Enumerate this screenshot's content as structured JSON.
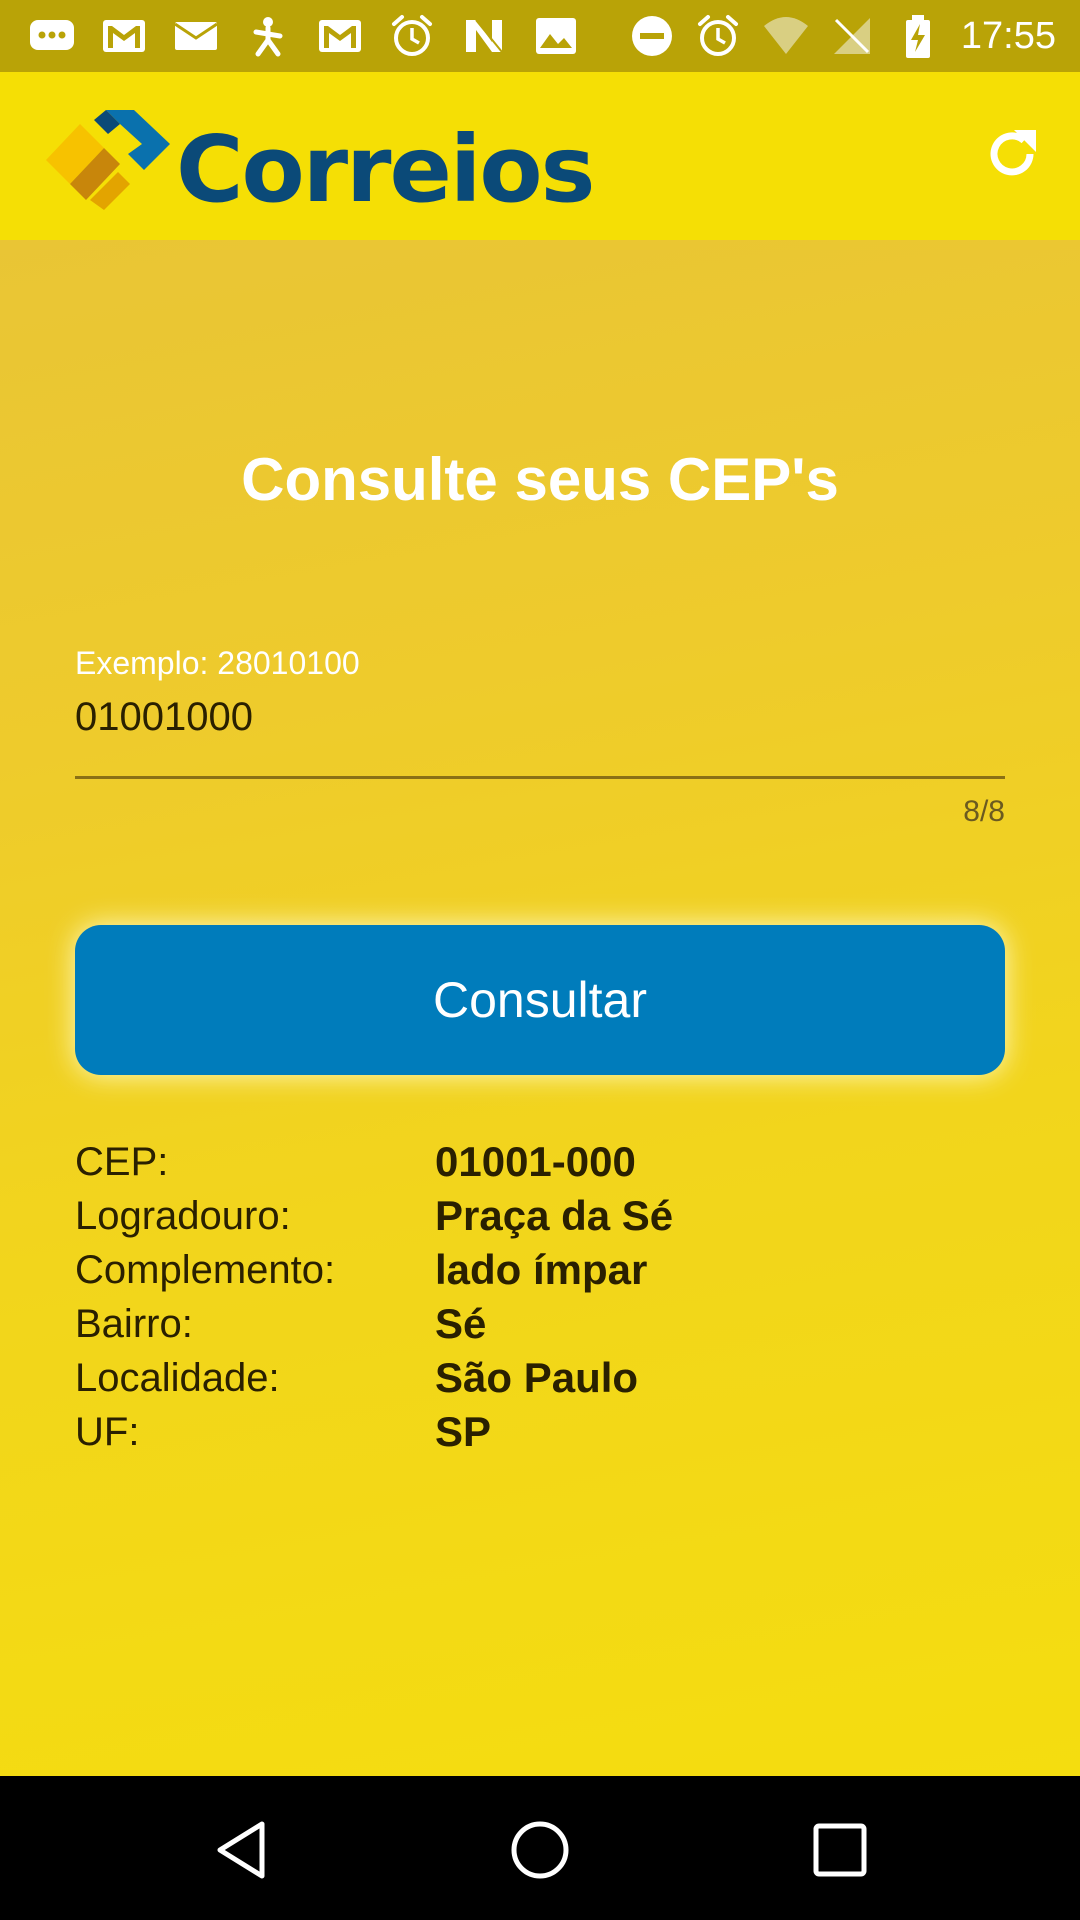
{
  "status_bar": {
    "time": "17:55",
    "icons": [
      "messages-icon",
      "gmail-icon",
      "email-icon",
      "app-icon",
      "gmail-icon",
      "alarm-icon",
      "n-icon",
      "image-icon",
      "do-not-disturb-icon",
      "alarm-icon",
      "wifi-icon",
      "no-signal-icon",
      "battery-charging-icon"
    ]
  },
  "app_bar": {
    "logo_text": "Correios",
    "refresh_icon": "refresh-icon"
  },
  "main": {
    "title": "Consulte seus CEP's",
    "cep_field": {
      "hint": "Exemplo: 28010100",
      "value": "01001000",
      "counter": "8/8"
    },
    "consult_button_label": "Consultar",
    "results": [
      {
        "label": "CEP:",
        "value": "01001-000"
      },
      {
        "label": "Logradouro:",
        "value": "Praça da Sé"
      },
      {
        "label": "Complemento:",
        "value": "lado ímpar"
      },
      {
        "label": "Bairro:",
        "value": "Sé"
      },
      {
        "label": "Localidade:",
        "value": "São Paulo"
      },
      {
        "label": "UF:",
        "value": "SP"
      }
    ]
  },
  "nav_bar": {
    "buttons": [
      "back-icon",
      "home-icon",
      "recents-icon"
    ]
  },
  "colors": {
    "status_bar": "#b9a307",
    "app_bar": "#f5df05",
    "background": "#f2d814",
    "button": "#007cbb",
    "logo_blue": "#0b4a78",
    "text_dark": "#2a2000"
  }
}
